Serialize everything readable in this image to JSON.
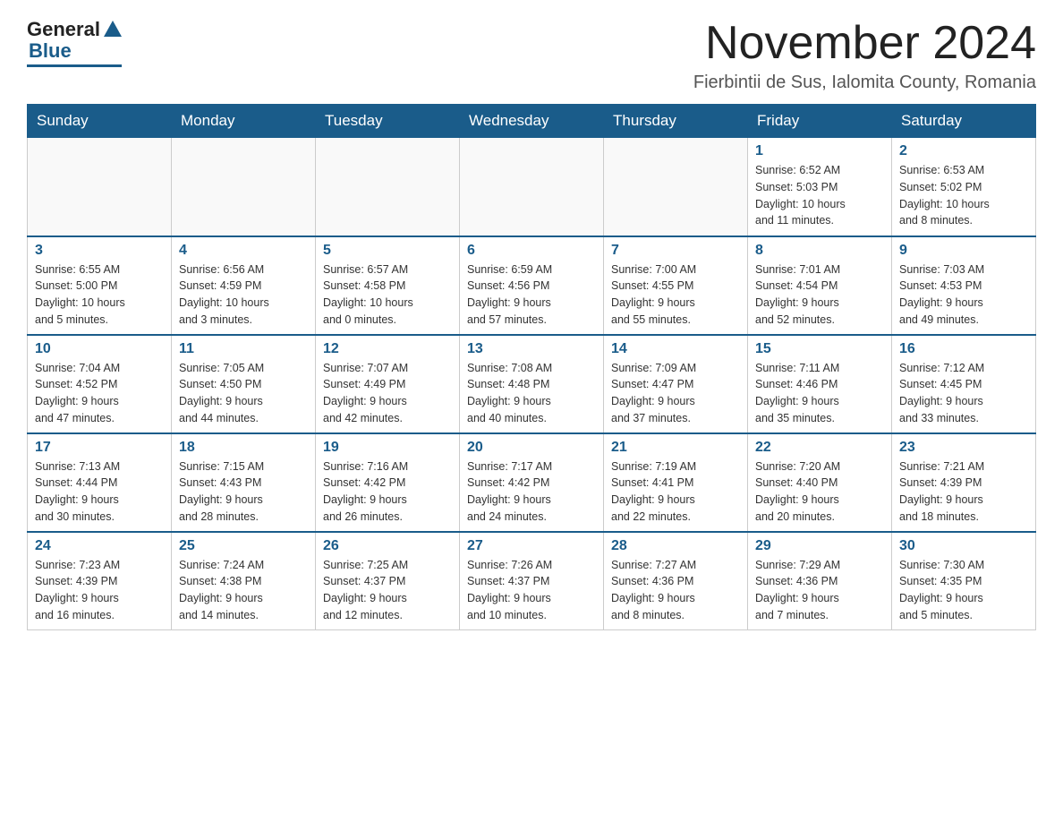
{
  "logo": {
    "general": "General",
    "blue": "Blue"
  },
  "header": {
    "month_title": "November 2024",
    "location": "Fierbintii de Sus, Ialomita County, Romania"
  },
  "weekdays": [
    "Sunday",
    "Monday",
    "Tuesday",
    "Wednesday",
    "Thursday",
    "Friday",
    "Saturday"
  ],
  "weeks": [
    [
      {
        "day": "",
        "detail": ""
      },
      {
        "day": "",
        "detail": ""
      },
      {
        "day": "",
        "detail": ""
      },
      {
        "day": "",
        "detail": ""
      },
      {
        "day": "",
        "detail": ""
      },
      {
        "day": "1",
        "detail": "Sunrise: 6:52 AM\nSunset: 5:03 PM\nDaylight: 10 hours\nand 11 minutes."
      },
      {
        "day": "2",
        "detail": "Sunrise: 6:53 AM\nSunset: 5:02 PM\nDaylight: 10 hours\nand 8 minutes."
      }
    ],
    [
      {
        "day": "3",
        "detail": "Sunrise: 6:55 AM\nSunset: 5:00 PM\nDaylight: 10 hours\nand 5 minutes."
      },
      {
        "day": "4",
        "detail": "Sunrise: 6:56 AM\nSunset: 4:59 PM\nDaylight: 10 hours\nand 3 minutes."
      },
      {
        "day": "5",
        "detail": "Sunrise: 6:57 AM\nSunset: 4:58 PM\nDaylight: 10 hours\nand 0 minutes."
      },
      {
        "day": "6",
        "detail": "Sunrise: 6:59 AM\nSunset: 4:56 PM\nDaylight: 9 hours\nand 57 minutes."
      },
      {
        "day": "7",
        "detail": "Sunrise: 7:00 AM\nSunset: 4:55 PM\nDaylight: 9 hours\nand 55 minutes."
      },
      {
        "day": "8",
        "detail": "Sunrise: 7:01 AM\nSunset: 4:54 PM\nDaylight: 9 hours\nand 52 minutes."
      },
      {
        "day": "9",
        "detail": "Sunrise: 7:03 AM\nSunset: 4:53 PM\nDaylight: 9 hours\nand 49 minutes."
      }
    ],
    [
      {
        "day": "10",
        "detail": "Sunrise: 7:04 AM\nSunset: 4:52 PM\nDaylight: 9 hours\nand 47 minutes."
      },
      {
        "day": "11",
        "detail": "Sunrise: 7:05 AM\nSunset: 4:50 PM\nDaylight: 9 hours\nand 44 minutes."
      },
      {
        "day": "12",
        "detail": "Sunrise: 7:07 AM\nSunset: 4:49 PM\nDaylight: 9 hours\nand 42 minutes."
      },
      {
        "day": "13",
        "detail": "Sunrise: 7:08 AM\nSunset: 4:48 PM\nDaylight: 9 hours\nand 40 minutes."
      },
      {
        "day": "14",
        "detail": "Sunrise: 7:09 AM\nSunset: 4:47 PM\nDaylight: 9 hours\nand 37 minutes."
      },
      {
        "day": "15",
        "detail": "Sunrise: 7:11 AM\nSunset: 4:46 PM\nDaylight: 9 hours\nand 35 minutes."
      },
      {
        "day": "16",
        "detail": "Sunrise: 7:12 AM\nSunset: 4:45 PM\nDaylight: 9 hours\nand 33 minutes."
      }
    ],
    [
      {
        "day": "17",
        "detail": "Sunrise: 7:13 AM\nSunset: 4:44 PM\nDaylight: 9 hours\nand 30 minutes."
      },
      {
        "day": "18",
        "detail": "Sunrise: 7:15 AM\nSunset: 4:43 PM\nDaylight: 9 hours\nand 28 minutes."
      },
      {
        "day": "19",
        "detail": "Sunrise: 7:16 AM\nSunset: 4:42 PM\nDaylight: 9 hours\nand 26 minutes."
      },
      {
        "day": "20",
        "detail": "Sunrise: 7:17 AM\nSunset: 4:42 PM\nDaylight: 9 hours\nand 24 minutes."
      },
      {
        "day": "21",
        "detail": "Sunrise: 7:19 AM\nSunset: 4:41 PM\nDaylight: 9 hours\nand 22 minutes."
      },
      {
        "day": "22",
        "detail": "Sunrise: 7:20 AM\nSunset: 4:40 PM\nDaylight: 9 hours\nand 20 minutes."
      },
      {
        "day": "23",
        "detail": "Sunrise: 7:21 AM\nSunset: 4:39 PM\nDaylight: 9 hours\nand 18 minutes."
      }
    ],
    [
      {
        "day": "24",
        "detail": "Sunrise: 7:23 AM\nSunset: 4:39 PM\nDaylight: 9 hours\nand 16 minutes."
      },
      {
        "day": "25",
        "detail": "Sunrise: 7:24 AM\nSunset: 4:38 PM\nDaylight: 9 hours\nand 14 minutes."
      },
      {
        "day": "26",
        "detail": "Sunrise: 7:25 AM\nSunset: 4:37 PM\nDaylight: 9 hours\nand 12 minutes."
      },
      {
        "day": "27",
        "detail": "Sunrise: 7:26 AM\nSunset: 4:37 PM\nDaylight: 9 hours\nand 10 minutes."
      },
      {
        "day": "28",
        "detail": "Sunrise: 7:27 AM\nSunset: 4:36 PM\nDaylight: 9 hours\nand 8 minutes."
      },
      {
        "day": "29",
        "detail": "Sunrise: 7:29 AM\nSunset: 4:36 PM\nDaylight: 9 hours\nand 7 minutes."
      },
      {
        "day": "30",
        "detail": "Sunrise: 7:30 AM\nSunset: 4:35 PM\nDaylight: 9 hours\nand 5 minutes."
      }
    ]
  ]
}
